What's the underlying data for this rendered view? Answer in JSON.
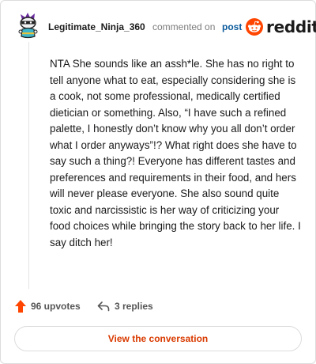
{
  "comment": {
    "username": "Legitimate_Ninja_360",
    "action_text": "commented on",
    "post_link_text": "post",
    "body": "NTA She sounds like an assh*le. She has no right to tell anyone what to eat, especially considering she is a cook, not some professional, medically certified dietician or something. Also, “I have such a refined palette, I honestly don’t know why you all don’t order what I order anyways”!? What right does she have to say such a thing?! Everyone has different tastes and preferences and requirements in their food, and hers will never please everyone. She also sound quite toxic and narcissistic is her way of criticizing your food choices while bringing the story back to her life. I say ditch her!",
    "upvotes_text": "96 upvotes",
    "replies_text": "3 replies"
  },
  "brand": {
    "wordmark": "reddit",
    "accent_color": "#ff4500"
  },
  "footer": {
    "view_button_label": "View the conversation"
  },
  "icons": {
    "avatar": "snoo-avatar-icon",
    "logo": "reddit-logo-icon",
    "upvote": "upvote-arrow-icon",
    "reply": "reply-arrow-icon"
  }
}
